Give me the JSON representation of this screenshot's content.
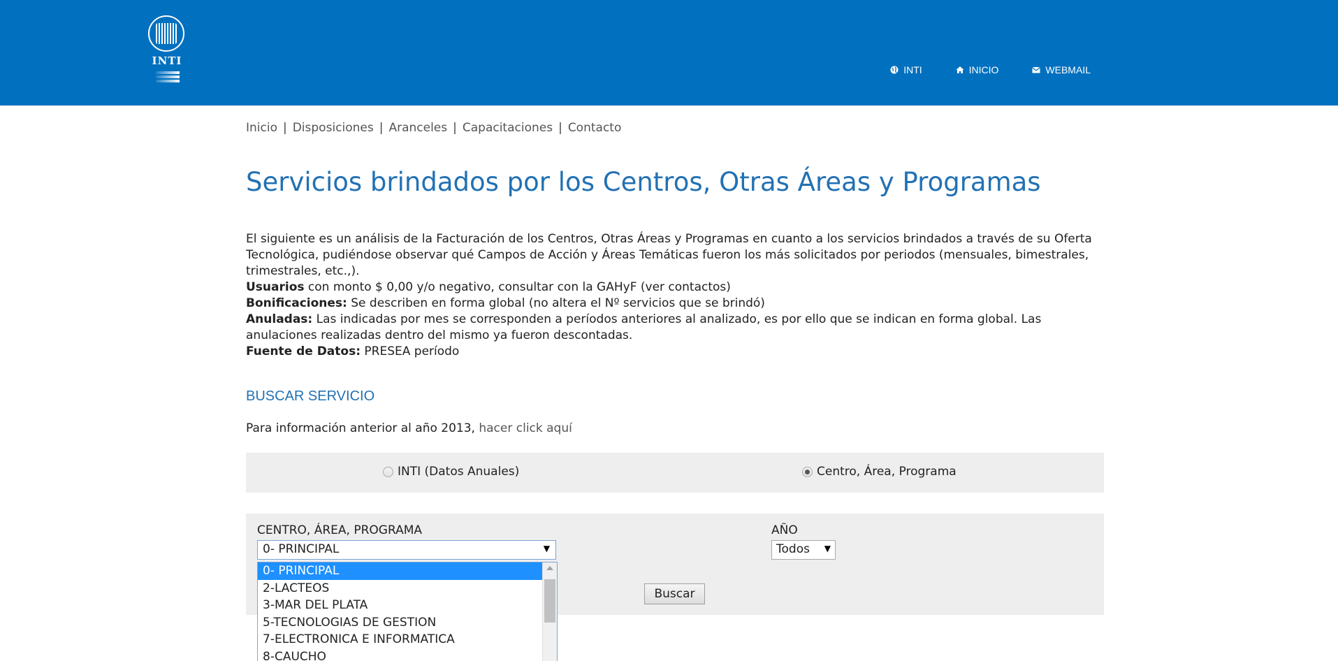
{
  "header": {
    "logo_text": "INTI",
    "nav": [
      {
        "label": "INTI",
        "icon": "globe-icon"
      },
      {
        "label": "INICIO",
        "icon": "home-icon"
      },
      {
        "label": "WEBMAIL",
        "icon": "mail-icon"
      }
    ],
    "background_color": "#0070bf"
  },
  "breadcrumb": [
    "Inicio",
    "Disposiciones",
    "Aranceles",
    "Capacitaciones",
    "Contacto"
  ],
  "page_title": "Servicios brindados por los Centros, Otras Áreas y Programas",
  "intro": {
    "paragraph": "El siguiente es un análisis de la Facturación de los Centros, Otras Áreas y Programas en cuanto a los servicios brindados a través de su Oferta Tecnológica, pudiéndose observar qué Campos de Acción y Áreas Temáticas fueron los más solicitados por periodos (mensuales, bimestrales, trimestrales, etc.,).",
    "usuarios_label": "Usuarios",
    "usuarios_text": " con monto $ 0,00 y/o negativo, consultar con la GAHyF (ver contactos)",
    "bonificaciones_label": "Bonificaciones:",
    "bonificaciones_text": " Se describen en forma global (no altera el Nº servicios que se brindó)",
    "anuladas_label": "Anuladas:",
    "anuladas_text": " Las indicadas por mes se corresponden a períodos anteriores al analizado, es por ello que se indican en forma global. Las anulaciones realizadas dentro del mismo ya fueron descontadas.",
    "fuente_label": "Fuente de Datos:",
    "fuente_text": " PRESEA período"
  },
  "section_title": "BUSCAR SERVICIO",
  "prev_info": {
    "text": "Para información anterior al año 2013, ",
    "link": "hacer click aquí"
  },
  "radios": [
    {
      "label": "INTI (Datos Anuales)",
      "checked": false
    },
    {
      "label": "Centro, Área, Programa",
      "checked": true
    }
  ],
  "search": {
    "centro_label": "CENTRO, ÁREA, PROGRAMA",
    "centro_value": "0- PRINCIPAL",
    "anio_label": "AÑO",
    "anio_value": "Todos",
    "buscar_label": "Buscar"
  },
  "dropdown_options": [
    "0- PRINCIPAL",
    "2-LACTEOS",
    "3-MAR DEL PLATA",
    "5-TECNOLOGIAS DE GESTION",
    "7-ELECTRONICA E INFORMATICA",
    "8-CAUCHO"
  ],
  "colors": {
    "title": "#2271b3",
    "selected_option": "#1e90ff",
    "panel": "#eeeeee"
  }
}
